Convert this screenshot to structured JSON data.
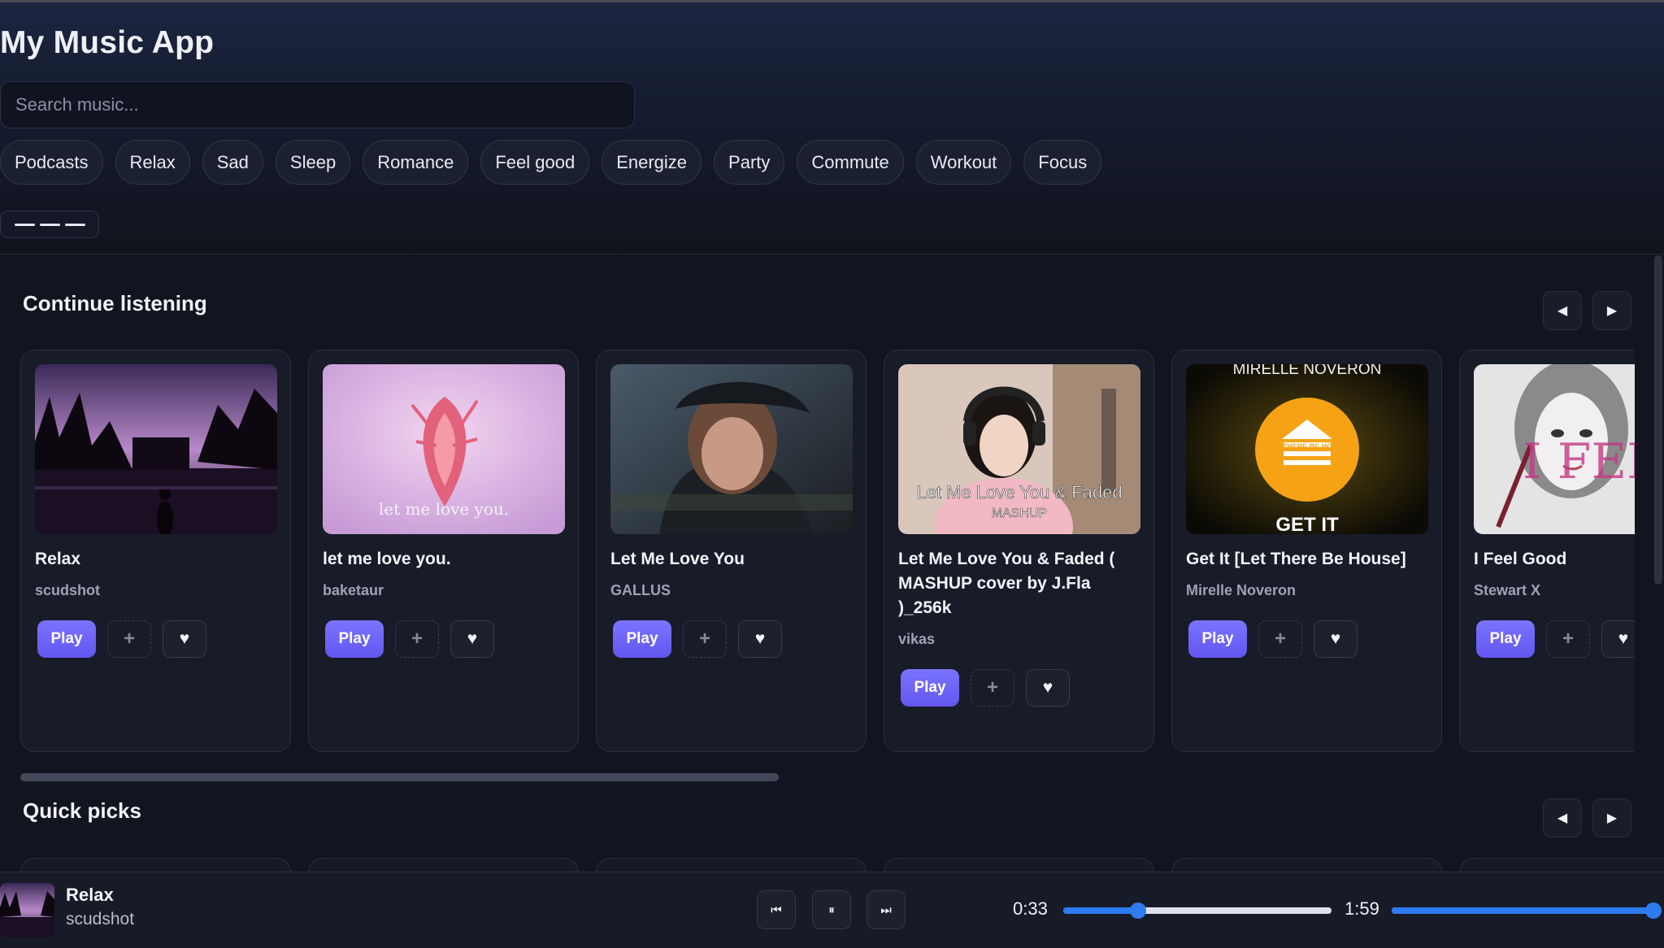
{
  "app": {
    "title": "My Music App",
    "search_placeholder": "Search music...",
    "moods": [
      "Podcasts",
      "Relax",
      "Sad",
      "Sleep",
      "Romance",
      "Feel good",
      "Energize",
      "Party",
      "Commute",
      "Workout",
      "Focus"
    ]
  },
  "sections": [
    {
      "title": "Continue listening",
      "cards": [
        {
          "title": "Relax",
          "artist": "scudshot",
          "play_label": "Play",
          "art": "palm-lake-sunset",
          "art_text": ""
        },
        {
          "title": "let me love you.",
          "artist": "baketaur",
          "play_label": "Play",
          "art": "pink-heart-feathers",
          "art_text": "let me love you."
        },
        {
          "title": "Let Me Love You",
          "artist": "GALLUS",
          "play_label": "Play",
          "art": "girl-cap-portrait",
          "art_text": ""
        },
        {
          "title": "Let Me Love You & Faded ( MASHUP cover by J.Fla )_256k",
          "artist": "vikas",
          "play_label": "Play",
          "art": "singer-headphones",
          "art_text": "Let Me Love You & Faded",
          "art_subtext": "MASHUP"
        },
        {
          "title": "Get It [Let There Be House]",
          "artist": "Mirelle Noveron",
          "play_label": "Play",
          "art": "house-sun-poster",
          "art_text": "MIRELLE NOVERON",
          "art_badge": "LET THERE BE HOUSE",
          "art_subtext": "GET IT"
        },
        {
          "title": "I Feel Good",
          "artist": "Stewart X",
          "play_label": "Play",
          "art": "sketch-face",
          "art_text": "I FEEL GOOD"
        }
      ]
    },
    {
      "title": "Quick picks",
      "cards": []
    }
  ],
  "player": {
    "title": "Relax",
    "artist": "scudshot",
    "current_time": "0:33",
    "duration": "1:59",
    "progress": 0.28,
    "volume": 1.0
  },
  "icons": {
    "prev": "◀",
    "next": "▶",
    "skip_back": "⏮",
    "pause": "⏸",
    "skip_forward": "⏭",
    "add": "+",
    "like": "♥"
  },
  "colors": {
    "accent": "#6b63f5",
    "slider": "#2f7bf0"
  }
}
